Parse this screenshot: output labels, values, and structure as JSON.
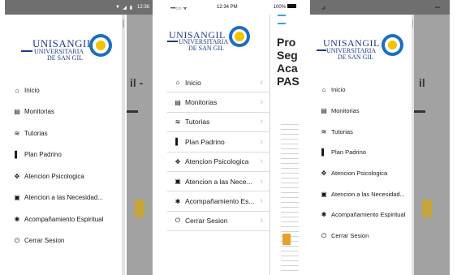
{
  "logo": {
    "line1": "UNISANGIL",
    "line2": "UNIVERSITARIA",
    "line3": "DE SAN GIL"
  },
  "screen1": {
    "status_time": "12:36",
    "bg_text": "il -",
    "menu": [
      {
        "icon": "home-icon",
        "glyph": "⌂",
        "label": "Inicio"
      },
      {
        "icon": "clipboard-icon",
        "glyph": "▤",
        "label": "Monitorias"
      },
      {
        "icon": "layers-icon",
        "glyph": "≋",
        "label": "Tutorias"
      },
      {
        "icon": "book-icon",
        "glyph": "▌",
        "label": "Plan Padrino"
      },
      {
        "icon": "handshake-icon",
        "glyph": "✥",
        "label": "Atencion Psicologica"
      },
      {
        "icon": "list-box-icon",
        "glyph": "▣",
        "label": "Atencion a las Necesidad..."
      },
      {
        "icon": "person-icon",
        "glyph": "✱",
        "label": "Acompañamiento Espiritual"
      },
      {
        "icon": "power-icon",
        "glyph": "⏻",
        "label": "Cerrar Sesion"
      }
    ]
  },
  "screen2": {
    "status_carrier": "•••○○ ᯤ",
    "status_time": "12:34 PM",
    "status_battery": "100%",
    "bg_lines": [
      "Pro",
      "Seg",
      "Aca",
      "PAS"
    ],
    "menu": [
      {
        "icon": "home-icon",
        "glyph": "⌂",
        "label": "Inicio"
      },
      {
        "icon": "clipboard-icon",
        "glyph": "▤",
        "label": "Monitorias"
      },
      {
        "icon": "layers-icon",
        "glyph": "≋",
        "label": "Tutorias"
      },
      {
        "icon": "book-icon",
        "glyph": "▌",
        "label": "Plan Padrino"
      },
      {
        "icon": "handshake-icon",
        "glyph": "✥",
        "label": "Atencion Psicologica"
      },
      {
        "icon": "list-box-icon",
        "glyph": "▣",
        "label": "Atencion a las Nece..."
      },
      {
        "icon": "person-icon",
        "glyph": "✱",
        "label": "Acompañamiento Es..."
      },
      {
        "icon": "power-icon",
        "glyph": "⏻",
        "label": "Cerrar Sesion"
      }
    ]
  },
  "screen3": {
    "bg_text": "il",
    "menu": [
      {
        "icon": "home-icon",
        "glyph": "⌂",
        "label": "Inicio"
      },
      {
        "icon": "clipboard-icon",
        "glyph": "▤",
        "label": "Monitorias"
      },
      {
        "icon": "layers-icon",
        "glyph": "≋",
        "label": "Tutorias"
      },
      {
        "icon": "book-icon",
        "glyph": "▌",
        "label": "Plan Padrino"
      },
      {
        "icon": "handshake-icon",
        "glyph": "✥",
        "label": "Atencion Psicologica"
      },
      {
        "icon": "list-box-icon",
        "glyph": "▣",
        "label": "Atencion a las Necesidad..."
      },
      {
        "icon": "person-icon",
        "glyph": "✱",
        "label": "Acompañamiento Espiritual"
      },
      {
        "icon": "power-icon",
        "glyph": "⏻",
        "label": "Cerrar Sesion"
      }
    ]
  },
  "colors": {
    "brand_blue": "#1f3a8a",
    "logo_yellow": "#f2c400",
    "scrim": "#a2a2a2"
  }
}
